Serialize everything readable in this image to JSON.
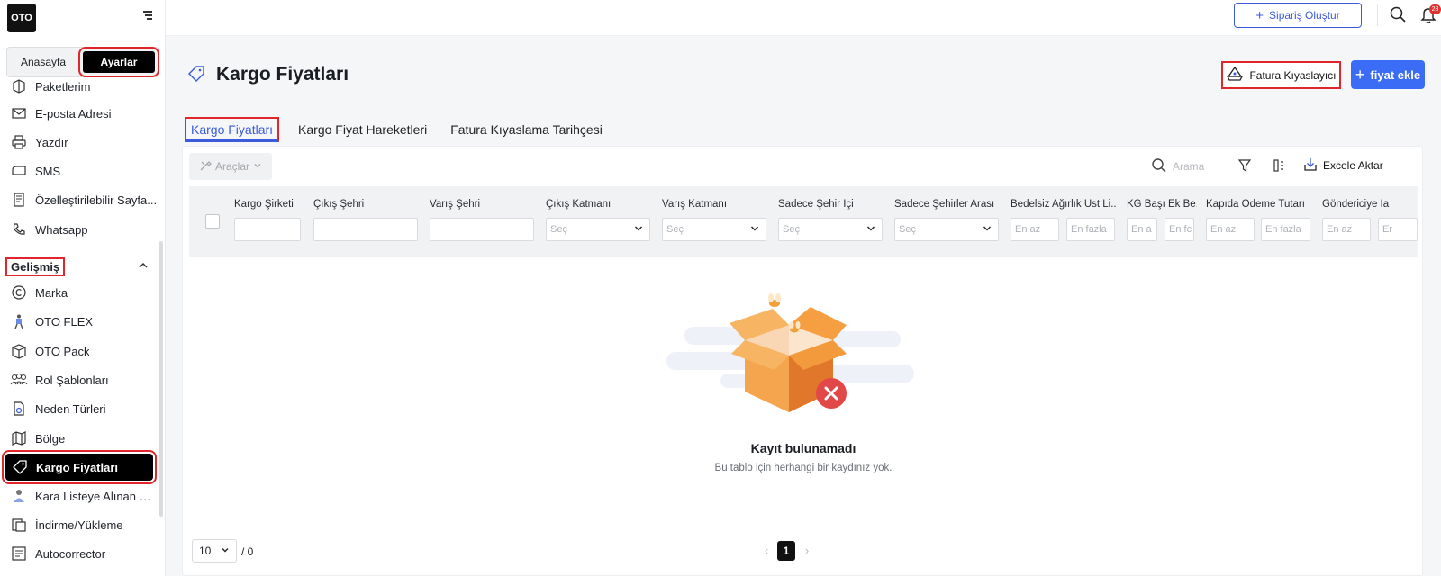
{
  "app": {
    "logo": "OTO"
  },
  "sidebar": {
    "tabs": [
      {
        "label": "Anasayfa"
      },
      {
        "label": "Ayarlar"
      }
    ],
    "items": [
      {
        "label": "Paketlerim",
        "icon": "package-icon"
      },
      {
        "label": "E-posta Adresi",
        "icon": "mail-icon"
      },
      {
        "label": "Yazdır",
        "icon": "printer-icon"
      },
      {
        "label": "SMS",
        "icon": "sms-icon"
      },
      {
        "label": "Özelleştirilebilir Sayfa...",
        "icon": "document-icon"
      },
      {
        "label": "Whatsapp",
        "icon": "phone-icon"
      }
    ],
    "section": {
      "label": "Gelişmiş",
      "icon": "chevron-up-icon"
    },
    "advanced_items": [
      {
        "label": "Marka",
        "icon": "copyright-icon"
      },
      {
        "label": "OTO FLEX",
        "icon": "courier-icon"
      },
      {
        "label": "OTO Pack",
        "icon": "box-icon"
      },
      {
        "label": "Rol Şablonları",
        "icon": "users-icon"
      },
      {
        "label": "Neden Türleri",
        "icon": "file-settings-icon"
      },
      {
        "label": "Bölge",
        "icon": "map-icon"
      },
      {
        "label": "Kargo Fiyatları",
        "icon": "price-tag-icon"
      },
      {
        "label": "Kara Listeye Alınan M...",
        "icon": "blocked-user-icon"
      },
      {
        "label": "İndirme/Yükleme",
        "icon": "download-upload-icon"
      },
      {
        "label": "Autocorrector",
        "icon": "autocorrect-icon"
      }
    ]
  },
  "topbar": {
    "create_order": "Sipariş Oluştur",
    "notification_count": "28"
  },
  "page": {
    "title": "Kargo Fiyatları",
    "compare_button": "Fatura Kıyaslayıcı",
    "add_button": "fiyat ekle",
    "tabs": [
      {
        "label": "Kargo Fiyatları"
      },
      {
        "label": "Kargo Fiyat Hareketleri"
      },
      {
        "label": "Fatura Kıyaslama Tarihçesi"
      }
    ]
  },
  "toolbar": {
    "tools_label": "Araçlar",
    "search_placeholder": "Arama",
    "excel_label": "Excele Aktar"
  },
  "table": {
    "columns": [
      {
        "label": "Kargo Şirketi"
      },
      {
        "label": "Çıkış Şehri"
      },
      {
        "label": "Varış Şehri"
      },
      {
        "label": "Çıkış Katmanı",
        "placeholder": "Seç"
      },
      {
        "label": "Varış Katmanı",
        "placeholder": "Seç"
      },
      {
        "label": "Sadece Şehir İçi",
        "placeholder": "Seç"
      },
      {
        "label": "Sadece Şehirler Arası",
        "placeholder": "Seç"
      },
      {
        "label": "Bedelsiz Ağırlık Üst Li...",
        "min": "En az",
        "max": "En fazla"
      },
      {
        "label": "KG Başı Ek Be...",
        "min": "En a",
        "max": "En fc"
      },
      {
        "label": "Kapıda Ödeme Tutarı",
        "min": "En az",
        "max": "En fazla"
      },
      {
        "label": "Göndericiye İa",
        "min": "En az",
        "max": "Er"
      }
    ],
    "empty_title": "Kayıt bulunamadı",
    "empty_subtitle": "Bu tablo için herhangi bir kaydınız yok."
  },
  "pagination": {
    "page_size": "10",
    "total": "/ 0",
    "current_page": "1"
  },
  "colors": {
    "accent": "#3b6cf6",
    "highlight": "#e0262a",
    "active_nav": "#000000"
  }
}
